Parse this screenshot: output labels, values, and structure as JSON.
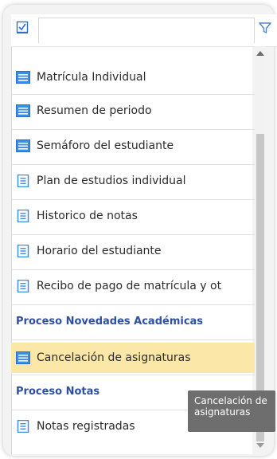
{
  "search": {
    "placeholder": ""
  },
  "list": {
    "items": [
      {
        "label": "Matrícula Individual",
        "icon": "list-icon-filled"
      },
      {
        "label": "Resumen de periodo",
        "icon": "list-icon-filled"
      },
      {
        "label": "Semáforo del estudiante",
        "icon": "list-icon-filled"
      },
      {
        "label": "Plan de estudios individual",
        "icon": "doc-icon"
      },
      {
        "label": "Historico de notas",
        "icon": "doc-icon"
      },
      {
        "label": "Horario del estudiante",
        "icon": "doc-icon"
      },
      {
        "label": "Recibo de pago de matrícula y ot",
        "icon": "doc-icon"
      },
      {
        "label": "Proceso Novedades Académicas",
        "header": true
      },
      {
        "label": "Cancelación de asignaturas",
        "icon": "list-icon-filled",
        "selected": true
      },
      {
        "label": "Proceso Notas",
        "header": true
      },
      {
        "label": "Notas registradas",
        "icon": "doc-icon"
      }
    ]
  },
  "tooltip": {
    "line1": "Cancelación de",
    "line2": "asignaturas"
  },
  "colors": {
    "accent": "#2f6fd3",
    "header": "#2f4fa3",
    "selected": "#fbe7a7",
    "tooltip_bg": "#6e6e6e"
  }
}
